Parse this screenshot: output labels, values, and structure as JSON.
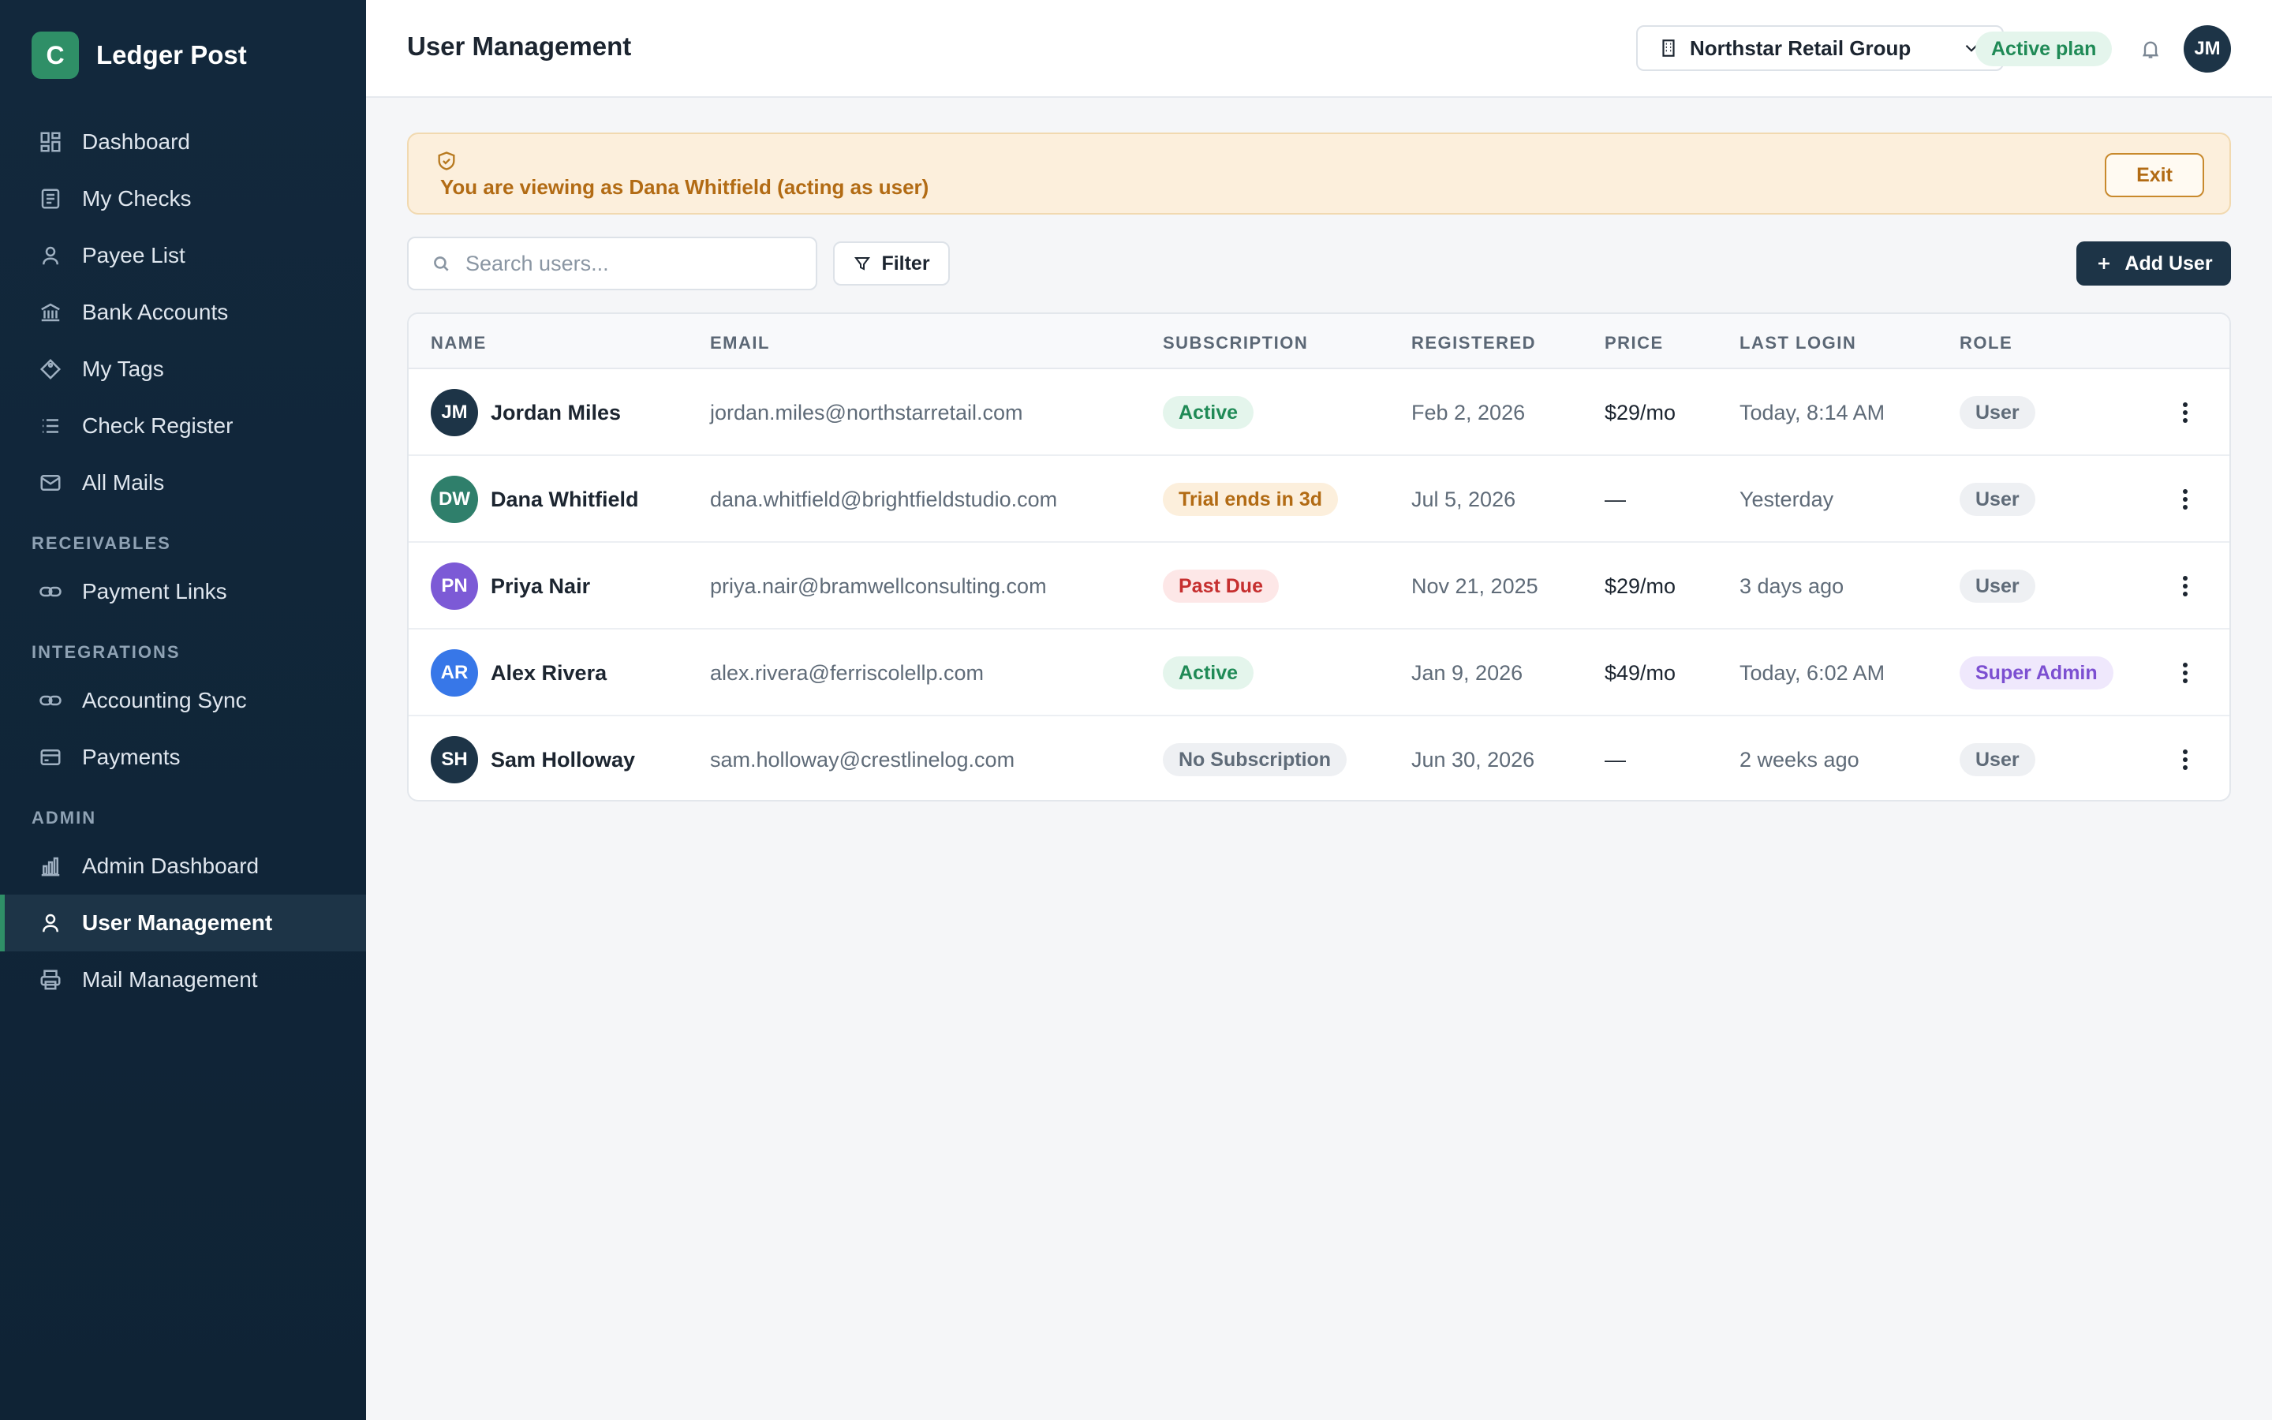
{
  "app": {
    "brand_initial": "C",
    "brand_name": "Ledger Post"
  },
  "sidebar": {
    "main_items": [
      {
        "label": "Dashboard",
        "icon": "grid-icon"
      },
      {
        "label": "My Checks",
        "icon": "document-icon"
      },
      {
        "label": "Payee List",
        "icon": "user-icon"
      },
      {
        "label": "Bank Accounts",
        "icon": "bank-icon"
      },
      {
        "label": "My Tags",
        "icon": "tag-icon"
      },
      {
        "label": "Check Register",
        "icon": "list-icon"
      },
      {
        "label": "All Mails",
        "icon": "mail-icon"
      }
    ],
    "receivables_label": "RECEIVABLES",
    "receivables_items": [
      {
        "label": "Payment Links",
        "icon": "link-icon"
      }
    ],
    "integrations_label": "INTEGRATIONS",
    "integrations_items": [
      {
        "label": "Accounting Sync",
        "icon": "link-icon"
      },
      {
        "label": "Payments",
        "icon": "card-icon"
      }
    ],
    "admin_label": "ADMIN",
    "admin_items": [
      {
        "label": "Admin Dashboard",
        "icon": "bar-chart-icon"
      },
      {
        "label": "User Management",
        "icon": "user-icon",
        "active": true
      },
      {
        "label": "Mail Management",
        "icon": "printer-icon"
      }
    ]
  },
  "header": {
    "title": "User Management",
    "org": "Northstar Retail Group",
    "plan_badge": "Active plan",
    "avatar_initials": "JM"
  },
  "banner": {
    "message": "You are viewing as Dana Whitfield (acting as user)",
    "exit_label": "Exit"
  },
  "toolbar": {
    "search_placeholder": "Search users...",
    "filter_label": "Filter",
    "add_label": "Add User"
  },
  "table": {
    "columns": [
      "NAME",
      "EMAIL",
      "SUBSCRIPTION",
      "REGISTERED",
      "PRICE",
      "LAST LOGIN",
      "ROLE"
    ],
    "rows": [
      {
        "initials": "JM",
        "avatar_color": "#1d3447",
        "name": "Jordan Miles",
        "email": "jordan.miles@northstarretail.com",
        "subscription": "Active",
        "sub_status": "active",
        "registered": "Feb 2, 2026",
        "price": "$29/mo",
        "last_login": "Today, 8:14 AM",
        "role": "User",
        "role_type": "user"
      },
      {
        "initials": "DW",
        "avatar_color": "#2f7f6b",
        "name": "Dana Whitfield",
        "email": "dana.whitfield@brightfieldstudio.com",
        "subscription": "Trial ends in 3d",
        "sub_status": "trial",
        "registered": "Jul 5, 2026",
        "price": "—",
        "last_login": "Yesterday",
        "role": "User",
        "role_type": "user"
      },
      {
        "initials": "PN",
        "avatar_color": "#7c5ad6",
        "name": "Priya Nair",
        "email": "priya.nair@bramwellconsulting.com",
        "subscription": "Past Due",
        "sub_status": "pastdue",
        "registered": "Nov 21, 2025",
        "price": "$29/mo",
        "last_login": "3 days ago",
        "role": "User",
        "role_type": "user"
      },
      {
        "initials": "AR",
        "avatar_color": "#3777e8",
        "name": "Alex Rivera",
        "email": "alex.rivera@ferriscolellp.com",
        "subscription": "Active",
        "sub_status": "active",
        "registered": "Jan 9, 2026",
        "price": "$49/mo",
        "last_login": "Today, 6:02 AM",
        "role": "Super Admin",
        "role_type": "superadmin"
      },
      {
        "initials": "SH",
        "avatar_color": "#1d3447",
        "name": "Sam Holloway",
        "email": "sam.holloway@crestlinelog.com",
        "subscription": "No Subscription",
        "sub_status": "none",
        "registered": "Jun 30, 2026",
        "price": "—",
        "last_login": "2 weeks ago",
        "role": "User",
        "role_type": "user"
      }
    ]
  },
  "colors": {
    "accent": "#2f8f67",
    "navy": "#1d3447",
    "status_active_bg": "#e4f5ec",
    "status_active_fg": "#1f8a56",
    "status_trial_bg": "#fcefdc",
    "status_trial_fg": "#b26b14",
    "status_pastdue_bg": "#fde7e7",
    "status_pastdue_fg": "#c62f2f",
    "status_none_bg": "#eef0f3",
    "status_none_fg": "#5f6b78",
    "role_user_bg": "#eef0f3",
    "role_user_fg": "#5f6b78",
    "role_superadmin_bg": "#efe8fc",
    "role_superadmin_fg": "#7c4fd1"
  }
}
